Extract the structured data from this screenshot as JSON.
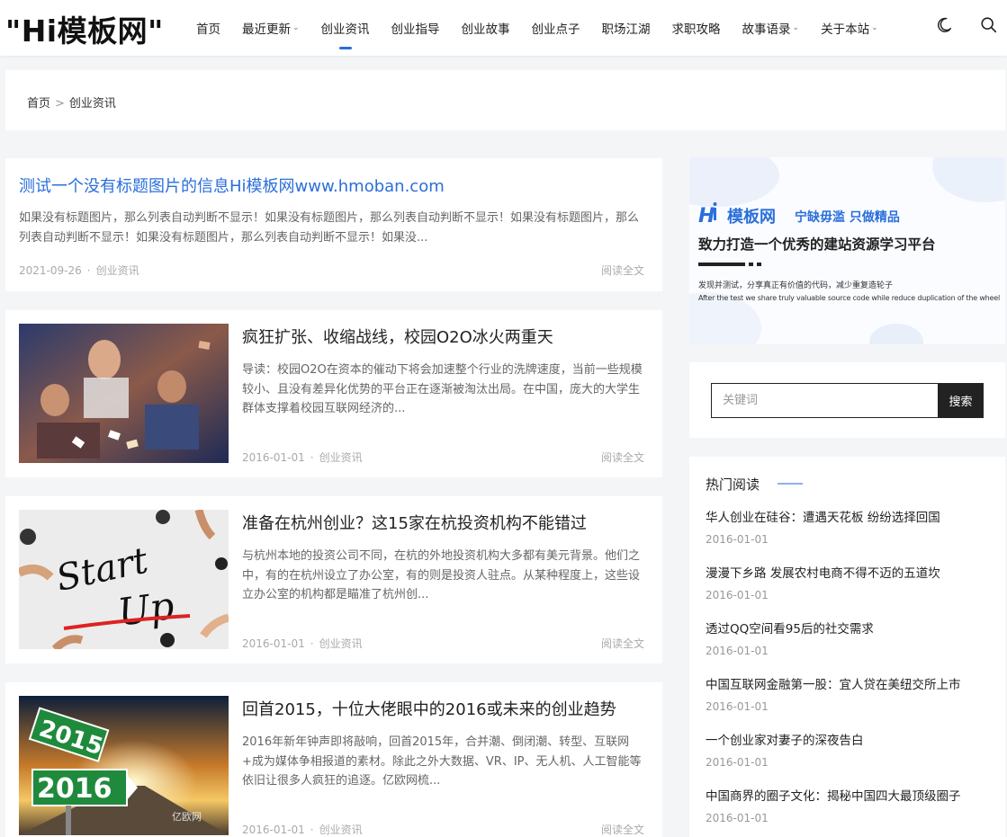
{
  "site": {
    "logo": "\"Hi模板网\""
  },
  "nav": {
    "items": [
      {
        "label": "首页",
        "has_dropdown": false,
        "active": false
      },
      {
        "label": "最近更新",
        "has_dropdown": true,
        "active": false
      },
      {
        "label": "创业资讯",
        "has_dropdown": false,
        "active": true
      },
      {
        "label": "创业指导",
        "has_dropdown": false,
        "active": false
      },
      {
        "label": "创业故事",
        "has_dropdown": false,
        "active": false
      },
      {
        "label": "创业点子",
        "has_dropdown": false,
        "active": false
      },
      {
        "label": "职场江湖",
        "has_dropdown": false,
        "active": false
      },
      {
        "label": "求职攻略",
        "has_dropdown": false,
        "active": false
      },
      {
        "label": "故事语录",
        "has_dropdown": true,
        "active": false
      },
      {
        "label": "关于本站",
        "has_dropdown": true,
        "active": false
      }
    ],
    "chevron": "⌄"
  },
  "breadcrumb": {
    "home": "首页",
    "sep": ">",
    "current": "创业资讯"
  },
  "articles": [
    {
      "title": "测试一个没有标题图片的信息Hi模板网www.hmoban.com",
      "excerpt": "如果没有标题图片，那么列表自动判断不显示！如果没有标题图片，那么列表自动判断不显示！如果没有标题图片，那么列表自动判断不显示！如果没有标题图片，那么列表自动判断不显示！如果没...",
      "date": "2021-09-26",
      "category": "创业资讯",
      "readmore": "阅读全文"
    },
    {
      "title": "疯狂扩张、收缩战线，校园O2O冰火两重天",
      "excerpt": "导读：校园O2O在资本的催动下将会加速整个行业的洗牌速度，当前一些规模较小、且没有差异化优势的平台正在逐渐被淘汰出局。在中国，庞大的大学生群体支撑着校园互联网经济的...",
      "date": "2016-01-01",
      "category": "创业资讯",
      "readmore": "阅读全文"
    },
    {
      "title": "准备在杭州创业？这15家在杭投资机构不能错过",
      "excerpt": "与杭州本地的投资公司不同，在杭的外地投资机构大多都有美元背景。他们之中，有的在杭州设立了办公室，有的则是投资人驻点。从某种程度上，这些设立办公室的机构都是瞄准了杭州创...",
      "date": "2016-01-01",
      "category": "创业资讯",
      "readmore": "阅读全文",
      "thumb_text": [
        "Start",
        "Up"
      ]
    },
    {
      "title": "回首2015，十位大佬眼中的2016或未来的创业趋势",
      "excerpt": "2016年新年钟声即将敲响，回首2015年，合并潮、倒闭潮、转型、互联网+成为媒体争相报道的素材。除此之外大数据、VR、IP、无人机、人工智能等依旧让很多人疯狂的追逐。亿欧网梳...",
      "date": "2016-01-01",
      "category": "创业资讯",
      "readmore": "阅读全文",
      "thumb_text": [
        "2015",
        "2016",
        "亿欧网"
      ]
    }
  ],
  "meta_dot": "·",
  "banner": {
    "brand": "模板网",
    "slogan": "宁缺毋滥 只做精品",
    "headline": "致力打造一个优秀的建站资源学习平台",
    "sub_cn": "发现并测试，分享真正有价值的代码，减少重复造轮子",
    "sub_en": "After the test we share truly valuable source code while reduce duplication of the wheel"
  },
  "search": {
    "placeholder": "关键词",
    "button": "搜索"
  },
  "hot": {
    "title": "热门阅读",
    "items": [
      {
        "title": "华人创业在硅谷：遭遇天花板 纷纷选择回国",
        "date": "2016-01-01"
      },
      {
        "title": "漫漫下乡路 发展农村电商不得不迈的五道坎",
        "date": "2016-01-01"
      },
      {
        "title": "透过QQ空间看95后的社交需求",
        "date": "2016-01-01"
      },
      {
        "title": "中国互联网金融第一股：宜人贷在美纽交所上市",
        "date": "2016-01-01"
      },
      {
        "title": "一个创业家对妻子的深夜告白",
        "date": "2016-01-01"
      },
      {
        "title": "中国商界的圈子文化：揭秘中国四大最顶级圈子",
        "date": "2016-01-01"
      }
    ]
  },
  "colors": {
    "accent": "#2a6fdb",
    "dark": "#222222"
  }
}
